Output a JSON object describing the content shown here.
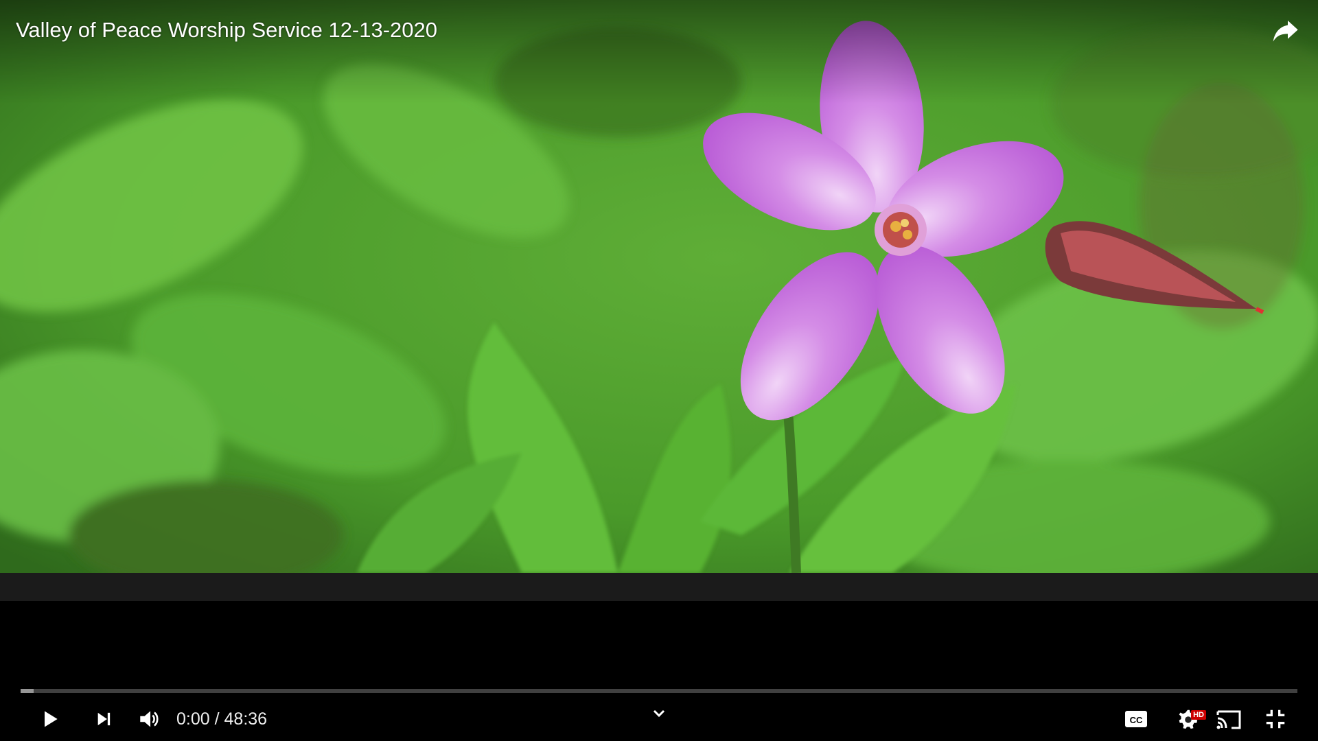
{
  "video": {
    "title": "Valley of Peace Worship Service 12-13-2020",
    "current_time": "0:00",
    "separator": " / ",
    "duration": "48:36",
    "played_fraction": 0.0,
    "loaded_fraction": 0.01
  },
  "controls": {
    "hd_badge": "HD",
    "icons": [
      "share-icon",
      "play-icon",
      "next-icon",
      "volume-icon",
      "chevron-down-icon",
      "captions-icon",
      "settings-icon",
      "cast-icon",
      "exit-fullscreen-icon"
    ]
  },
  "colors": {
    "progress_played": "#ff0000",
    "hd_badge": "#cc0000",
    "flower": "#c77ce0",
    "foliage": "#4f9a2d"
  }
}
